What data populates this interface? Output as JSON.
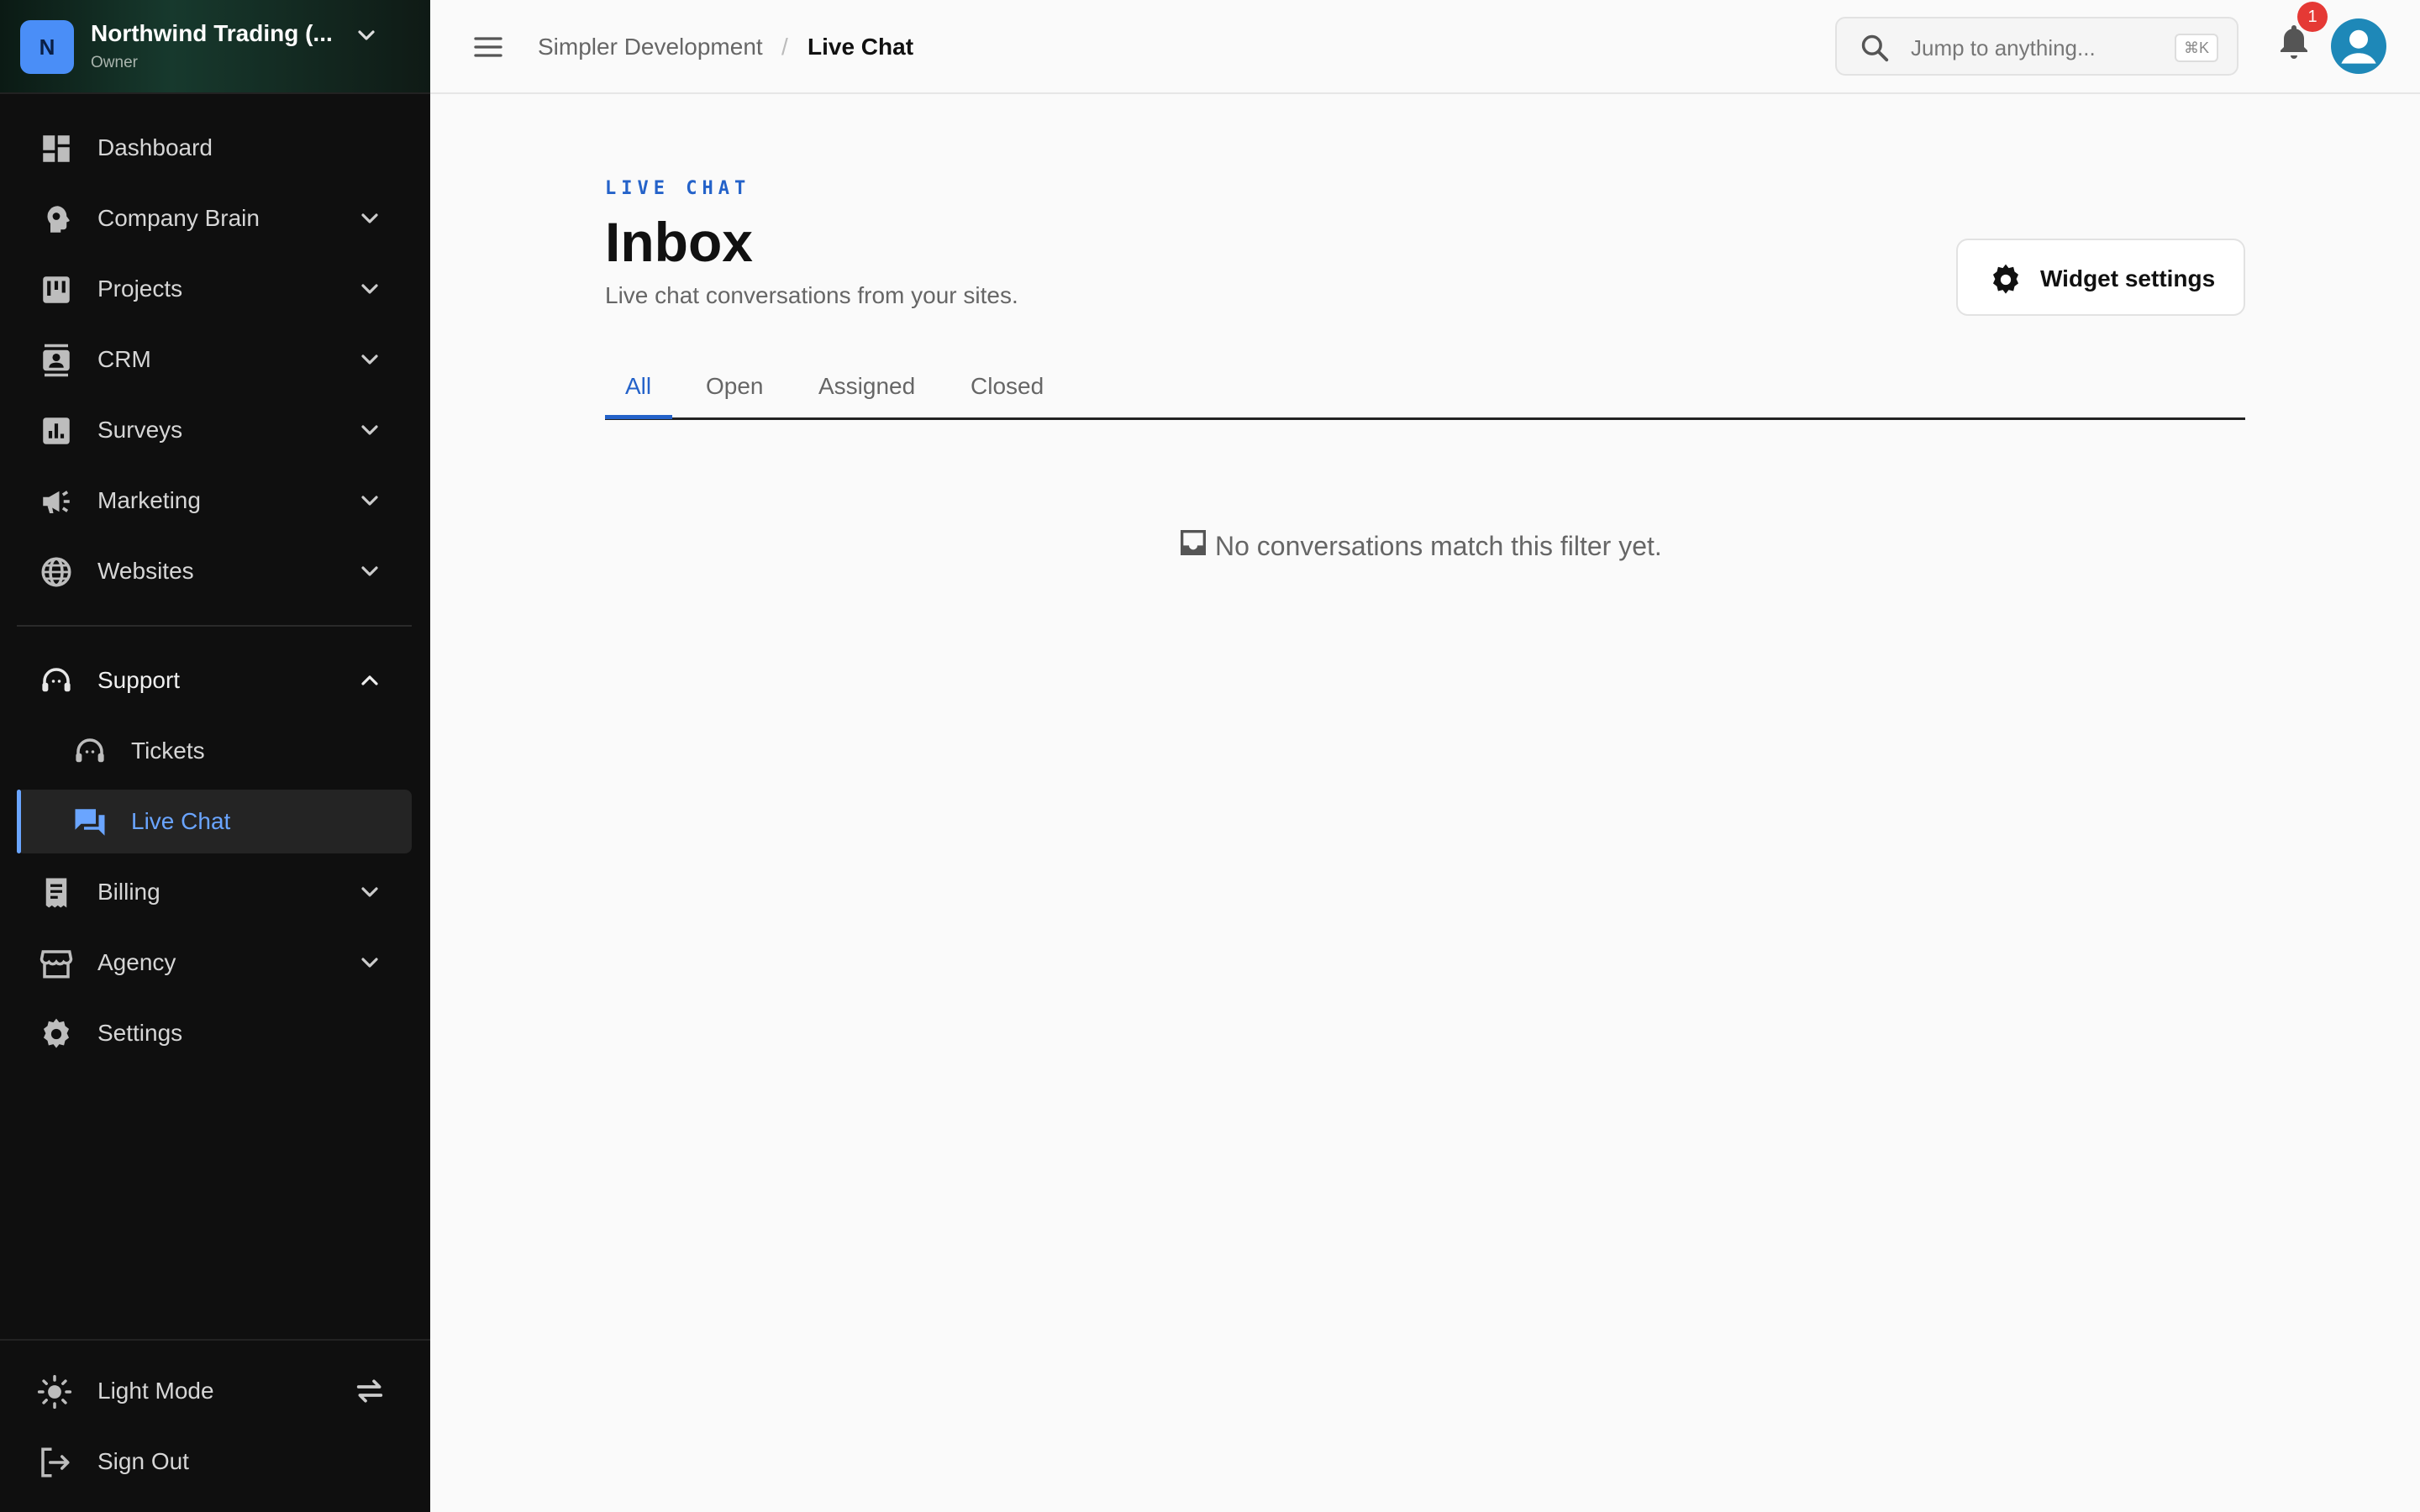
{
  "org": {
    "initial": "N",
    "name": "Northwind Trading (...",
    "role": "Owner"
  },
  "sidebar": {
    "items": [
      {
        "label": "Dashboard",
        "icon": "dashboard-icon"
      },
      {
        "label": "Company Brain",
        "icon": "brain-icon"
      },
      {
        "label": "Projects",
        "icon": "projects-icon"
      },
      {
        "label": "CRM",
        "icon": "contact-card-icon"
      },
      {
        "label": "Surveys",
        "icon": "bar-chart-icon"
      },
      {
        "label": "Marketing",
        "icon": "megaphone-icon"
      },
      {
        "label": "Websites",
        "icon": "globe-icon"
      },
      {
        "label": "Support",
        "icon": "headset-icon"
      },
      {
        "label": "Tickets",
        "icon": "headset-icon"
      },
      {
        "label": "Live Chat",
        "icon": "chat-bubbles-icon"
      },
      {
        "label": "Billing",
        "icon": "receipt-icon"
      },
      {
        "label": "Agency",
        "icon": "storefront-icon"
      },
      {
        "label": "Settings",
        "icon": "gear-icon"
      }
    ],
    "footer": {
      "theme_label": "Light Mode",
      "signout_label": "Sign Out"
    }
  },
  "topbar": {
    "breadcrumb": [
      "Simpler Development",
      "Live Chat"
    ],
    "breadcrumb_sep": "/",
    "search_placeholder": "Jump to anything...",
    "search_shortcut": "⌘K",
    "notification_count": "1"
  },
  "page": {
    "eyebrow": "LIVE CHAT",
    "title": "Inbox",
    "subtitle": "Live chat conversations from your sites.",
    "widget_button": "Widget settings",
    "tabs": [
      "All",
      "Open",
      "Assigned",
      "Closed"
    ],
    "active_tab": "All",
    "empty_message": "No conversations match this filter yet."
  },
  "colors": {
    "accent": "#2462c9",
    "sidebar_active": "#6aa5ff",
    "sidebar_bg": "#0f0f0f",
    "badge": "#e53935"
  }
}
